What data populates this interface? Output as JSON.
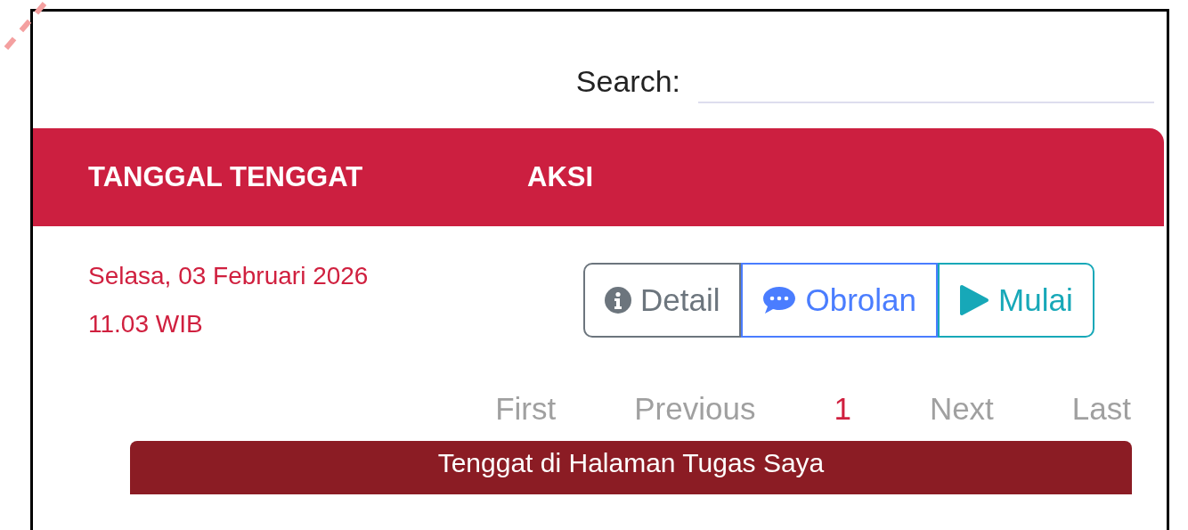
{
  "search": {
    "label": "Search:"
  },
  "table": {
    "columns": [
      "TANGGAL TENGGAT",
      "AKSI"
    ],
    "rows": [
      {
        "date": "Selasa, 03 Februari 2026",
        "time": "11.03 WIB",
        "actions": [
          {
            "kind": "info",
            "label": "Detail"
          },
          {
            "kind": "chat",
            "label": "Obrolan"
          },
          {
            "kind": "play",
            "label": "Mulai"
          }
        ]
      }
    ]
  },
  "pagination": [
    {
      "label": "First",
      "selected": false
    },
    {
      "label": "Previous",
      "selected": false
    },
    {
      "label": "1",
      "selected": true
    },
    {
      "label": "Next",
      "selected": false
    },
    {
      "label": "Last",
      "selected": false
    }
  ],
  "banner": {
    "text": "Tenggat di Halaman Tugas Saya"
  }
}
